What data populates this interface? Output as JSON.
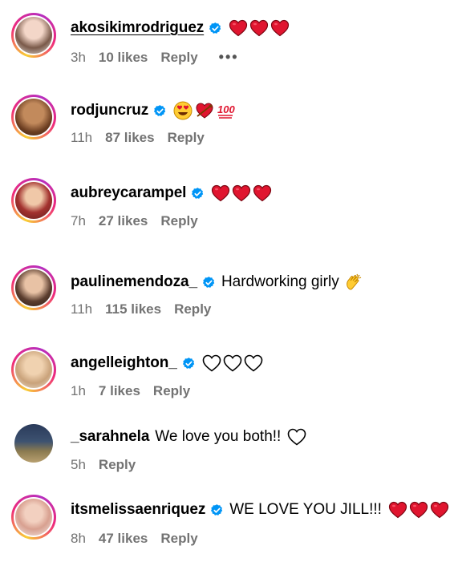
{
  "comments": [
    {
      "username": "akosikimrodriguez",
      "text": "",
      "time": "3h",
      "likes": "10 likes",
      "reply": "Reply",
      "more": "•••"
    },
    {
      "username": "rodjuncruz",
      "text": "",
      "time": "11h",
      "likes": "87 likes",
      "reply": "Reply"
    },
    {
      "username": "aubreycarampel",
      "text": "",
      "time": "7h",
      "likes": "27 likes",
      "reply": "Reply"
    },
    {
      "username": "paulinemendoza_",
      "text": "Hardworking girly",
      "time": "11h",
      "likes": "115 likes",
      "reply": "Reply"
    },
    {
      "username": "angelleighton_",
      "text": "",
      "time": "1h",
      "likes": "7 likes",
      "reply": "Reply"
    },
    {
      "username": "_sarahnela",
      "text": "We love you both!!",
      "time": "5h",
      "likes": "",
      "reply": "Reply"
    },
    {
      "username": "itsmelissaenriquez",
      "text": "WE LOVE YOU JILL!!!",
      "time": "8h",
      "likes": "47 likes",
      "reply": "Reply"
    }
  ],
  "colors": {
    "verified": "#0095f6",
    "heart": "#e0152f",
    "meta_text": "#737373"
  },
  "icons": [
    "verified-badge-icon",
    "red-heart-icon",
    "heart-outline-icon",
    "heart-eyes-emoji-icon",
    "heart-with-arrow-icon",
    "hundred-points-icon",
    "clapping-hands-icon",
    "more-options-icon"
  ]
}
